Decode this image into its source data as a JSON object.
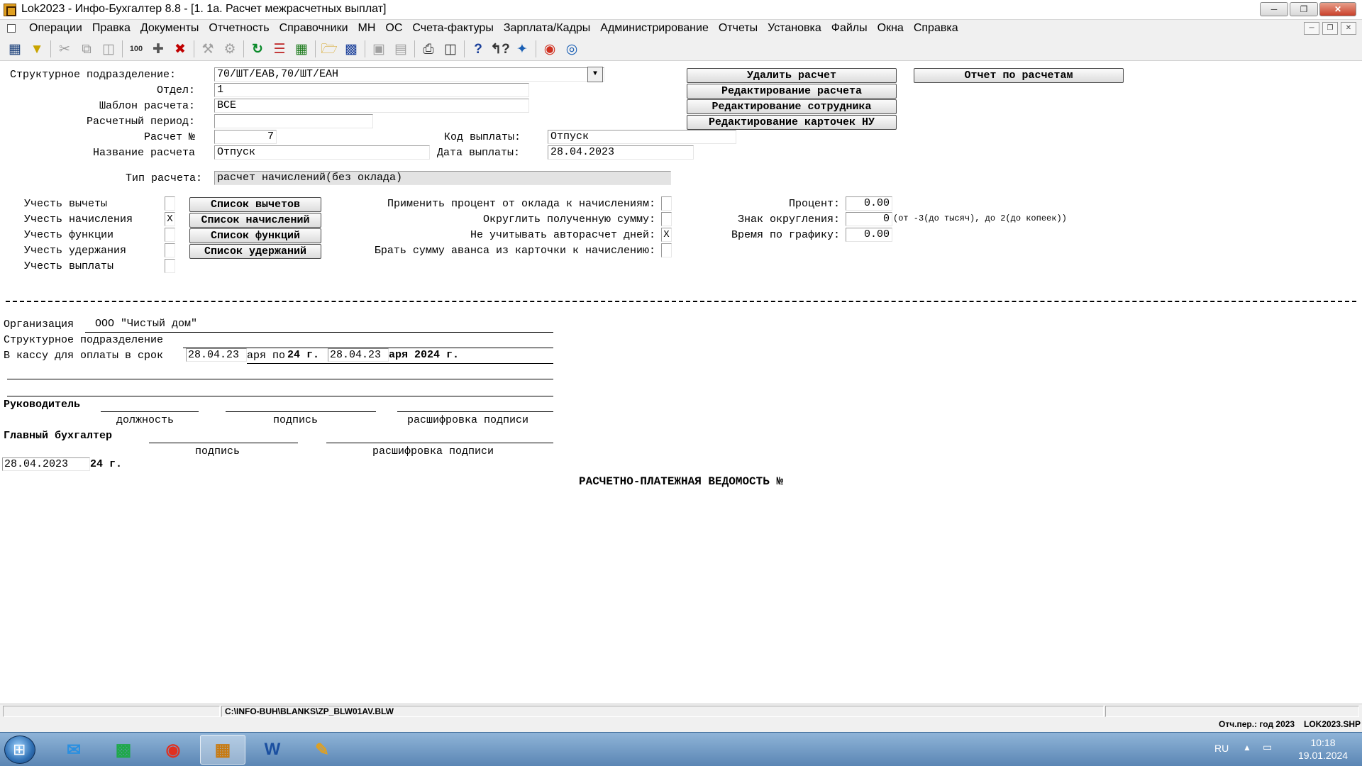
{
  "window": {
    "title": "Lok2023 - Инфо-Бухгалтер 8.8 - [1. 1а. Расчет межрасчетных выплат]",
    "min_icon": "minimize-icon",
    "max_icon": "restore-icon",
    "close_icon": "close-icon"
  },
  "menu": {
    "items": [
      "Операции",
      "Правка",
      "Документы",
      "Отчетность",
      "Справочники",
      "МН",
      "ОС",
      "Счета-фактуры",
      "Зарплата/Кадры",
      "Администрирование",
      "Отчеты",
      "Установка",
      "Файлы",
      "Окна",
      "Справка"
    ]
  },
  "form": {
    "struct_label": "Структурное подразделение:",
    "struct_value": "70/ШТ/ЕАВ,70/ШТ/ЕАН",
    "otdel_label": "Отдел:",
    "otdel_value": "1",
    "shablon_label": "Шаблон расчета:",
    "shablon_value": "ВСЕ",
    "period_label": "Расчетный период:",
    "period_value": "",
    "raschet_no_label": "Расчет №",
    "raschet_no_value": "7",
    "kod_label": "Код выплаты:",
    "kod_value": "Отпуск",
    "name_label": "Название расчета",
    "name_value": "Отпуск",
    "date_label": "Дата выплаты:",
    "date_value": "28.04.2023",
    "type_label": "Тип расчета:",
    "type_value": "расчет начислений(без оклада)"
  },
  "buttons": {
    "delete": "Удалить расчет",
    "report": "Отчет по расчетам",
    "edit_calc": "Редактирование расчета",
    "edit_emp": "Редактирование сотрудника",
    "edit_cards": "Редактирование карточек НУ",
    "list_deductions": "Список вычетов",
    "list_accruals": "Список начислений",
    "list_functions": "Список функций",
    "list_withholdings": "Список удержаний"
  },
  "options": {
    "deductions_label": "Учесть вычеты",
    "deductions_checked": "",
    "accruals_label": "Учесть начисления",
    "accruals_checked": "X",
    "functions_label": "Учесть функции",
    "functions_checked": "",
    "withholdings_label": "Учесть удержания",
    "withholdings_checked": "",
    "payments_label": "Учесть выплаты",
    "payments_checked": "",
    "apply_percent_label": "Применить процент от оклада к начислениям:",
    "apply_percent_checked": "",
    "round_label": "Округлить полученную сумму:",
    "round_checked": "",
    "ignore_auto_label": "Не учитывать авторасчет дней:",
    "ignore_auto_checked": "X",
    "advance_label": "Брать сумму аванса из карточки к начислению:",
    "advance_checked": "",
    "percent_label": "Процент:",
    "percent_value": "0.00",
    "round_sign_label": "Знак округления:",
    "round_sign_value": "0",
    "round_hint": "(от -3(до тысяч), до 2(до копеек))",
    "schedule_label": "Время по графику:",
    "schedule_value": "0.00"
  },
  "blank": {
    "org_label": "Организация",
    "org_value": "ООО \"Чистый дом\"",
    "struct_label": "Структурное подразделение",
    "cash_label": "В кассу для оплаты в срок",
    "cash_from": "28.04.23",
    "cash_text1": "аря по",
    "cash_text2": "24 г.",
    "cash_to": "28.04.23",
    "cash_text3": "аря 2024 г.",
    "head_label": "Руководитель",
    "position_caption": "должность",
    "signature_caption": "подпись",
    "decode_caption": "расшифровка подписи",
    "chief_label": "Главный бухгалтер",
    "signature_caption2": "подпись",
    "decode_caption2": "расшифровка подписи",
    "date_value": "28.04.2023",
    "date_suffix": "24 г.",
    "heading": "РАСЧЕТНО-ПЛАТЕЖНАЯ ВЕДОМОСТЬ №"
  },
  "status": {
    "path": "C:\\INFO-BUH\\BLANKS\\ZP_BLW01AV.BLW",
    "period": "Отч.пер.: год 2023",
    "file": "LOK2023.SHP"
  },
  "taskbar": {
    "lang": "RU",
    "time": "10:18",
    "date": "19.01.2024"
  }
}
